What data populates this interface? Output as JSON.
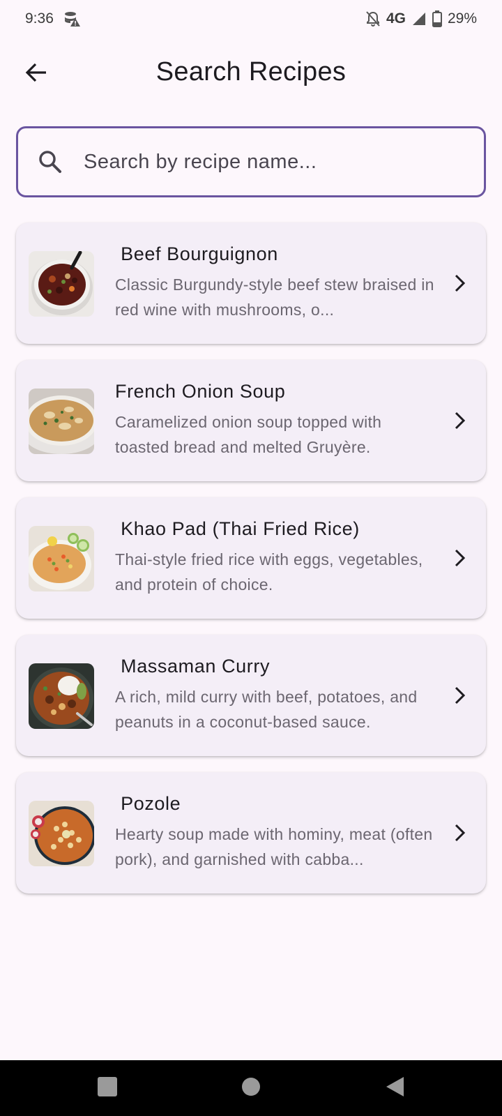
{
  "status_bar": {
    "time": "9:36",
    "network": "4G",
    "battery": "29%",
    "icons": [
      "data-saver-icon",
      "notifications-off-icon",
      "signal-icon",
      "battery-icon"
    ]
  },
  "app_bar": {
    "title": "Search Recipes",
    "back_icon": "arrow-back-icon"
  },
  "search": {
    "placeholder": "Search by recipe name...",
    "value": "",
    "icon": "search-icon",
    "accent_color": "#6a55a0"
  },
  "recipes": [
    {
      "name": " Beef Bourguignon",
      "description": "Classic Burgundy-style beef stew braised in red wine with mushrooms, o...",
      "image": "beef-bourguignon-thumbnail"
    },
    {
      "name": "French Onion Soup",
      "description": "Caramelized onion soup topped with toasted bread and melted Gruyère.",
      "image": "french-onion-soup-thumbnail"
    },
    {
      "name": " Khao Pad (Thai Fried Rice)",
      "description": "Thai-style fried rice with eggs, vegetables, and protein of choice.",
      "image": "khao-pad-thumbnail"
    },
    {
      "name": " Massaman Curry",
      "description": "A rich, mild curry with beef, potatoes, and peanuts in a coconut-based sauce.",
      "image": "massaman-curry-thumbnail"
    },
    {
      "name": " Pozole",
      "description": "Hearty soup made with hominy, meat (often pork), and garnished with cabba...",
      "image": "pozole-thumbnail"
    }
  ],
  "nav_bar": {
    "buttons": [
      "recents-button",
      "home-button",
      "back-button"
    ]
  }
}
